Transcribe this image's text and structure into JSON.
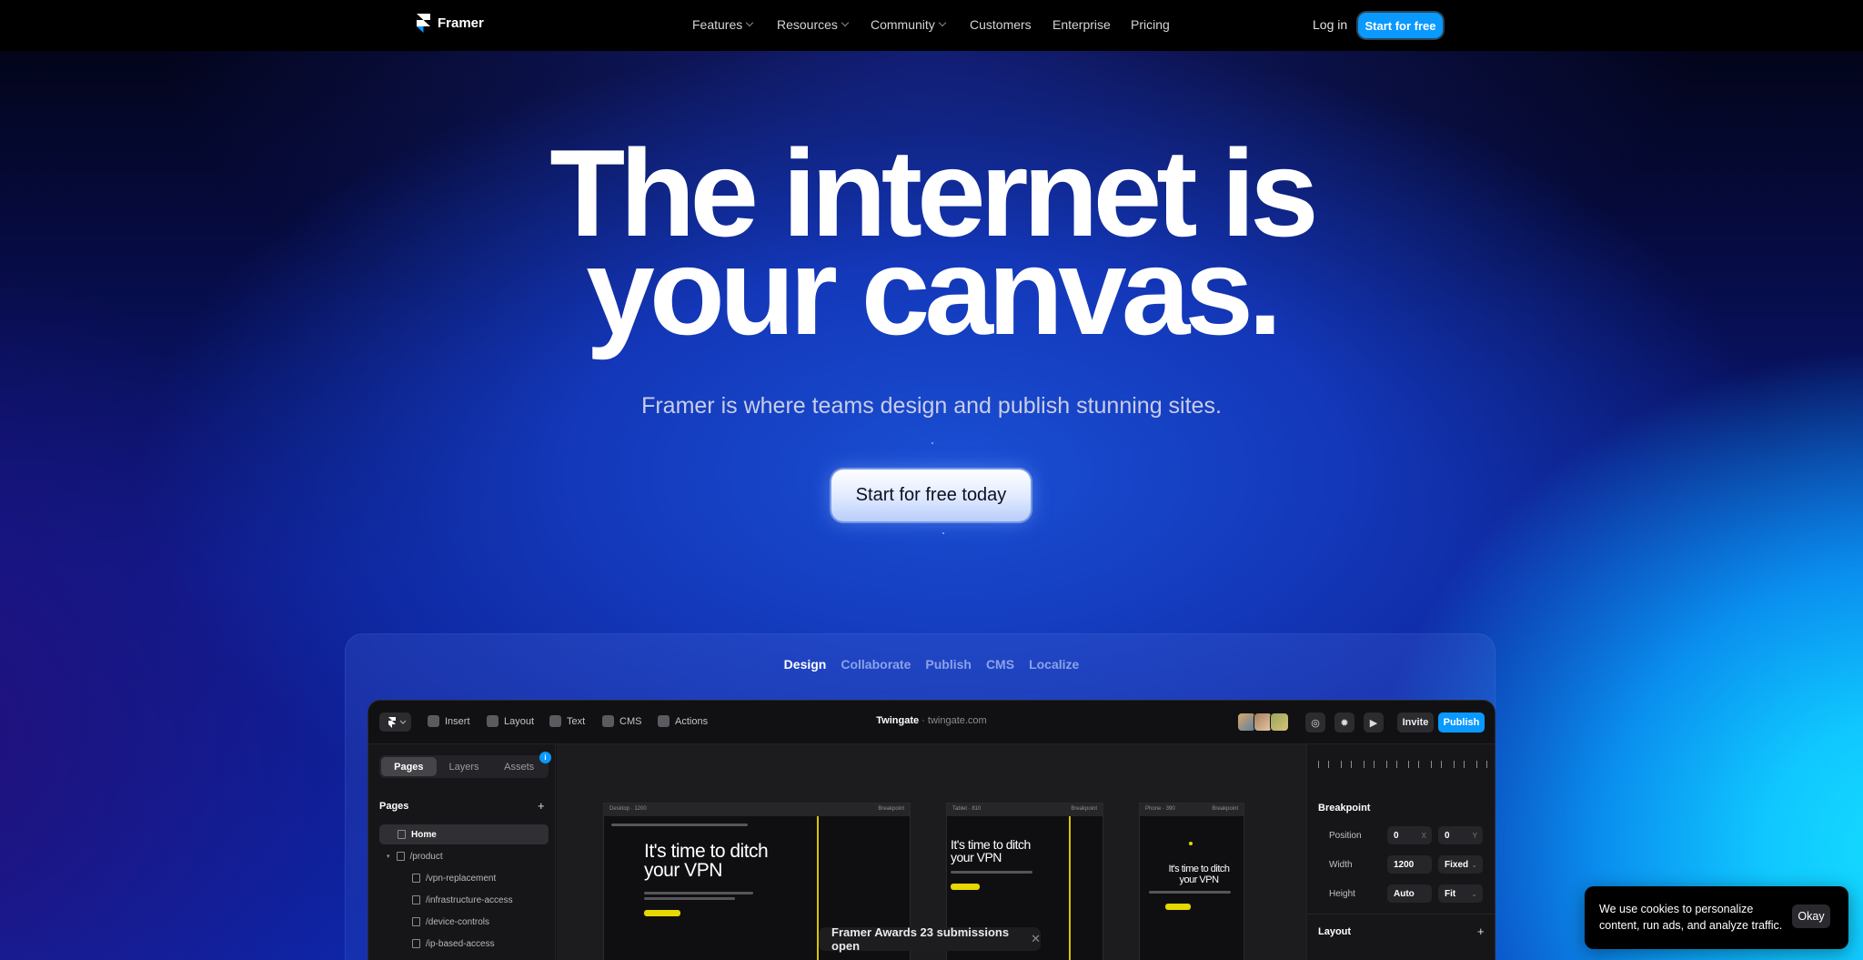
{
  "nav": {
    "brand": "Framer",
    "links": [
      {
        "label": "Features",
        "dropdown": true
      },
      {
        "label": "Resources",
        "dropdown": true
      },
      {
        "label": "Community",
        "dropdown": true
      },
      {
        "label": "Customers",
        "dropdown": false
      },
      {
        "label": "Enterprise",
        "dropdown": false
      },
      {
        "label": "Pricing",
        "dropdown": false
      }
    ],
    "login": "Log in",
    "cta": "Start for free"
  },
  "hero": {
    "headline_line1": "The internet is",
    "headline_line2": "your canvas.",
    "subline": "Framer is where teams design and publish stunning sites.",
    "cta": "Start for free today"
  },
  "showcase": {
    "tabs": [
      "Design",
      "Collaborate",
      "Publish",
      "CMS",
      "Localize"
    ],
    "active_tab": "Design"
  },
  "editor": {
    "toolbar": {
      "items": [
        "Insert",
        "Layout",
        "Text",
        "CMS",
        "Actions"
      ],
      "project_name": "Twingate",
      "project_domain": "twingate.com",
      "invite": "Invite",
      "publish": "Publish"
    },
    "left_panel": {
      "tabs": [
        "Pages",
        "Layers",
        "Assets"
      ],
      "active_tab": "Pages",
      "notification_badge": "i",
      "section_title": "Pages",
      "pages": [
        "Home",
        "/product",
        "/vpn-replacement",
        "/infrastructure-access",
        "/device-controls",
        "/ip-based-access"
      ]
    },
    "frames": [
      {
        "label": "Desktop · 1200",
        "tag": "Breakpoint",
        "heading": "It's time to ditch your VPN"
      },
      {
        "label": "Tablet · 810",
        "tag": "Breakpoint",
        "heading": "It's time to ditch your VPN"
      },
      {
        "label": "Phone · 390",
        "tag": "Breakpoint",
        "heading": "It's time to ditch your VPN"
      }
    ],
    "right_panel": {
      "section_title": "Breakpoint",
      "position_label": "Position",
      "position_x": "0",
      "position_x_unit": "X",
      "position_y": "0",
      "position_y_unit": "Y",
      "width_label": "Width",
      "width_value": "1200",
      "width_mode": "Fixed",
      "height_label": "Height",
      "height_value": "Auto",
      "height_mode": "Fit",
      "layout_title": "Layout"
    }
  },
  "awards_banner": "Framer Awards 23 submissions open",
  "cookie": {
    "text": "We use cookies to personalize content, run ads, and analyze traffic.",
    "button": "Okay"
  },
  "colors": {
    "accent": "#0a99ff",
    "frame_highlight": "#e6d800"
  }
}
